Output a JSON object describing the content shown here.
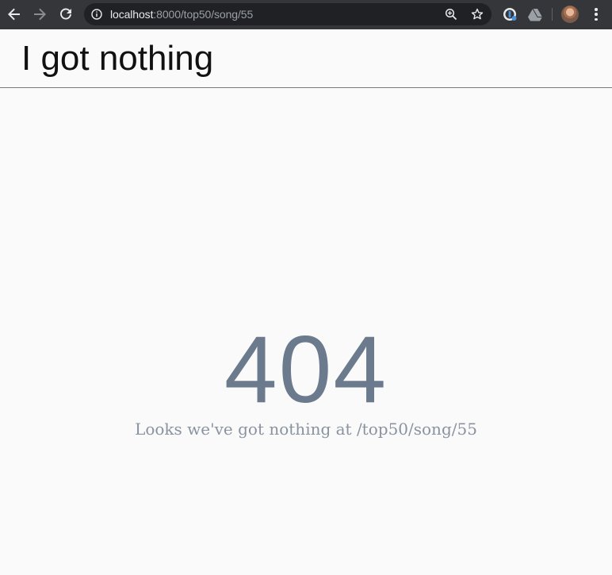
{
  "browser": {
    "url_host": "localhost",
    "url_rest": ":8000/top50/song/55",
    "icons": {
      "back": "arrow-left-icon",
      "forward": "arrow-right-icon",
      "reload": "reload-icon",
      "info": "info-icon",
      "zoom": "zoom-icon",
      "bookmark": "star-icon",
      "extension1": "password-manager-icon",
      "extension2": "drive-icon",
      "profile": "avatar",
      "menu": "more-vertical-icon"
    }
  },
  "page": {
    "header_title": "I got nothing",
    "error_code": "404",
    "error_message": "Looks we've got nothing at /top50/song/55"
  },
  "colors": {
    "toolbar": "#35363a",
    "omnibox": "#202124",
    "error_code": "#6b7b8d",
    "error_message": "#8993a0",
    "page_bg": "#fafafa"
  }
}
